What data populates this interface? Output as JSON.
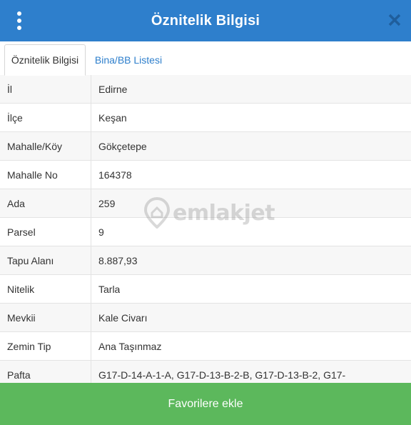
{
  "header": {
    "title": "Öznitelik Bilgisi",
    "menu_icon": "more-vertical-icon",
    "close_icon": "close-icon"
  },
  "tabs": [
    {
      "label": "Öznitelik Bilgisi",
      "active": true
    },
    {
      "label": "Bina/BB Listesi",
      "active": false
    }
  ],
  "rows": [
    {
      "label": "İl",
      "value": "Edirne"
    },
    {
      "label": "İlçe",
      "value": "Keşan"
    },
    {
      "label": "Mahalle/Köy",
      "value": "Gökçetepe"
    },
    {
      "label": "Mahalle No",
      "value": "164378"
    },
    {
      "label": "Ada",
      "value": "259"
    },
    {
      "label": "Parsel",
      "value": "9"
    },
    {
      "label": "Tapu Alanı",
      "value": "8.887,93"
    },
    {
      "label": "Nitelik",
      "value": "Tarla"
    },
    {
      "label": "Mevkii",
      "value": "Kale Civarı"
    },
    {
      "label": "Zemin Tip",
      "value": "Ana Taşınmaz"
    },
    {
      "label": "Pafta",
      "value": "G17-D-14-A-1-A, G17-D-13-B-2-B, G17-D-13-B-2, G17-"
    }
  ],
  "watermark": {
    "text": "emlakjet",
    "icon": "location-pin-icon"
  },
  "footer": {
    "button_label": "Favorilere ekle"
  },
  "colors": {
    "header_bg": "#2e7fcc",
    "tab_active_text": "#333333",
    "tab_inactive_text": "#2e7fcc",
    "button_bg": "#5cb85c"
  }
}
